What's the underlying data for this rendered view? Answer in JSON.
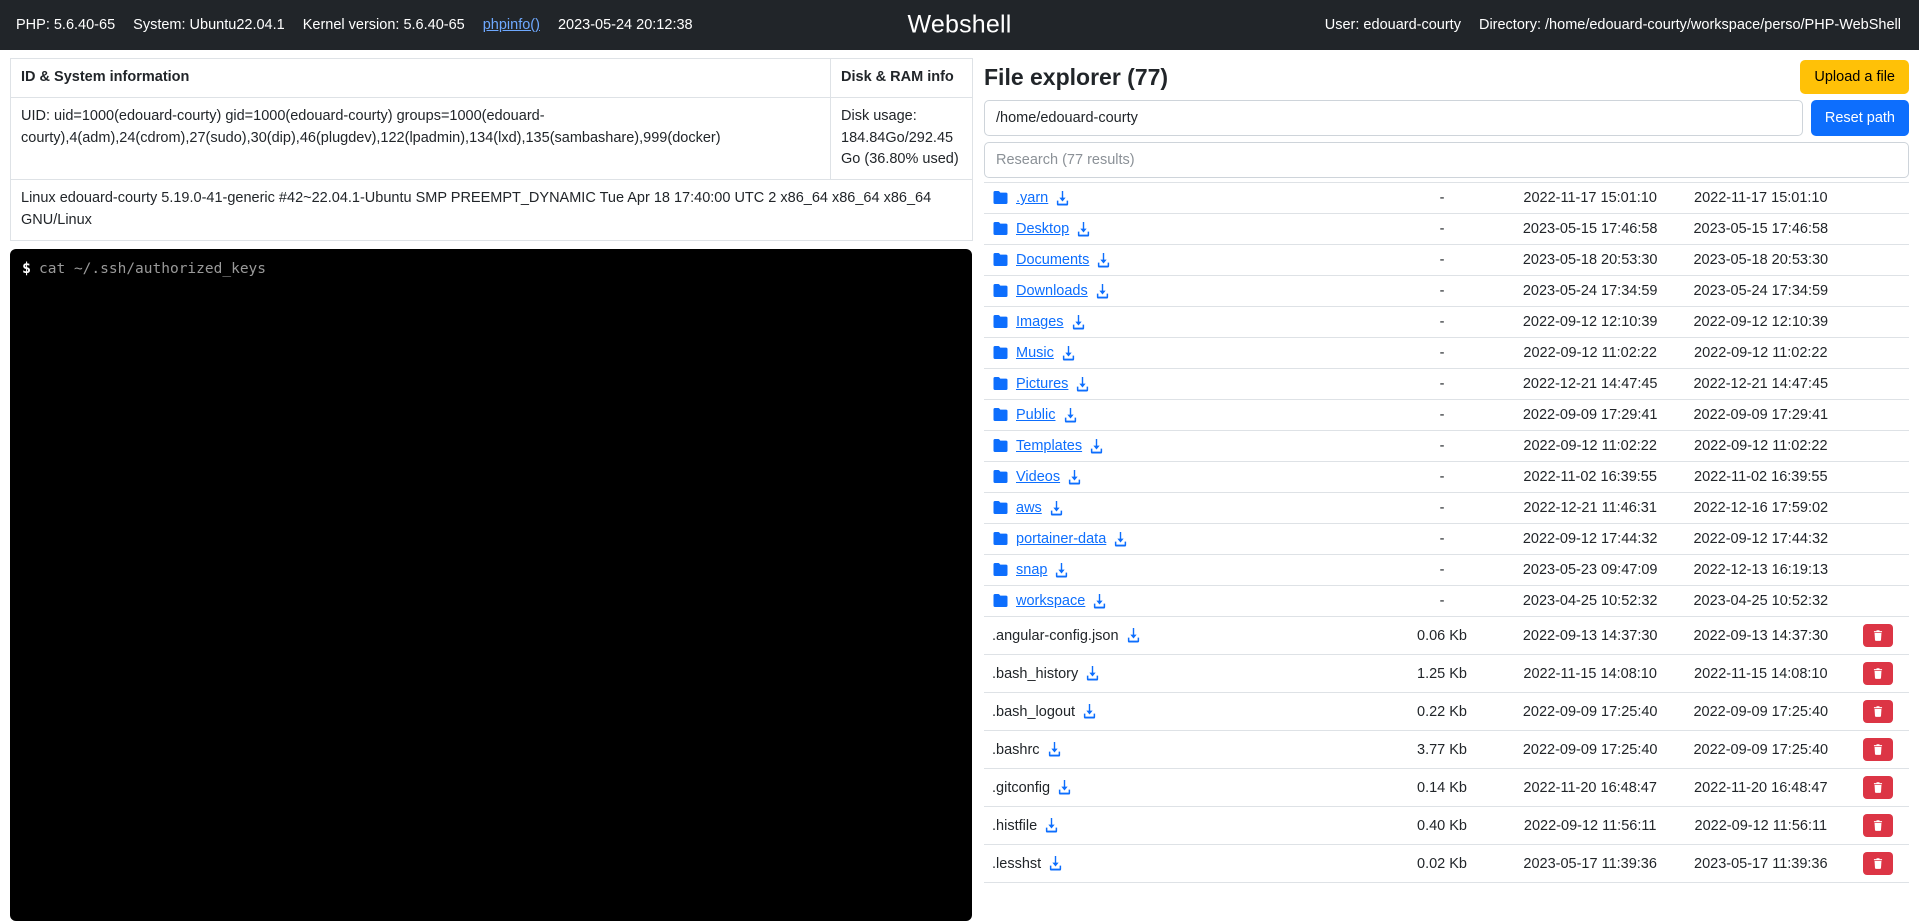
{
  "navbar": {
    "php": "PHP: 5.6.40-65",
    "system": "System: Ubuntu22.04.1",
    "kernel_version": "Kernel version: 5.6.40-65",
    "phpinfo_link": "phpinfo()",
    "datetime": "2023-05-24 20:12:38",
    "title": "Webshell",
    "user": "User: edouard-courty",
    "directory": "Directory: /home/edouard-courty/workspace/perso/PHP-WebShell",
    "bg_color": "#212529",
    "link_color": "#6ea8fe"
  },
  "info": {
    "header_id": "ID & System information",
    "header_disk": "Disk & RAM info",
    "uid": "UID: uid=1000(edouard-courty) gid=1000(edouard-courty) groups=1000(edouard-courty),4(adm),24(cdrom),27(sudo),30(dip),46(plugdev),122(lpadmin),134(lxd),135(sambashare),999(docker)",
    "disk": "Disk usage: 184.84Go/292.45 Go (36.80% used)",
    "uname": "Linux edouard-courty 5.19.0-41-generic #42~22.04.1-Ubuntu SMP PREEMPT_DYNAMIC Tue Apr 18 17:40:00 UTC 2 x86_64 x86_64 x86_64 GNU/Linux"
  },
  "terminal": {
    "prompt": "$",
    "command_placeholder": "cat ~/.ssh/authorized_keys",
    "command_value": "",
    "bg_color": "#000000"
  },
  "explorer": {
    "title": "File explorer (77)",
    "upload_label": "Upload a file",
    "reset_label": "Reset path",
    "path_value": "/home/edouard-courty",
    "path_placeholder": "/home/edouard-courty",
    "search_value": "",
    "search_placeholder": "Research (77 results)",
    "upload_color": "#ffc107",
    "reset_color": "#0d6efd",
    "delete_color": "#dc3545",
    "link_color": "#0d6efd",
    "icons": {
      "folder": "folder-icon",
      "download": "download-icon",
      "delete": "trash-icon"
    },
    "rows": [
      {
        "type": "folder",
        "name": ".yarn",
        "size": "-",
        "modified": "2022-11-17 15:01:10",
        "created": "2022-11-17 15:01:10",
        "deletable": false
      },
      {
        "type": "folder",
        "name": "Desktop",
        "size": "-",
        "modified": "2023-05-15 17:46:58",
        "created": "2023-05-15 17:46:58",
        "deletable": false
      },
      {
        "type": "folder",
        "name": "Documents",
        "size": "-",
        "modified": "2023-05-18 20:53:30",
        "created": "2023-05-18 20:53:30",
        "deletable": false
      },
      {
        "type": "folder",
        "name": "Downloads",
        "size": "-",
        "modified": "2023-05-24 17:34:59",
        "created": "2023-05-24 17:34:59",
        "deletable": false
      },
      {
        "type": "folder",
        "name": "Images",
        "size": "-",
        "modified": "2022-09-12 12:10:39",
        "created": "2022-09-12 12:10:39",
        "deletable": false
      },
      {
        "type": "folder",
        "name": "Music",
        "size": "-",
        "modified": "2022-09-12 11:02:22",
        "created": "2022-09-12 11:02:22",
        "deletable": false
      },
      {
        "type": "folder",
        "name": "Pictures",
        "size": "-",
        "modified": "2022-12-21 14:47:45",
        "created": "2022-12-21 14:47:45",
        "deletable": false
      },
      {
        "type": "folder",
        "name": "Public",
        "size": "-",
        "modified": "2022-09-09 17:29:41",
        "created": "2022-09-09 17:29:41",
        "deletable": false
      },
      {
        "type": "folder",
        "name": "Templates",
        "size": "-",
        "modified": "2022-09-12 11:02:22",
        "created": "2022-09-12 11:02:22",
        "deletable": false
      },
      {
        "type": "folder",
        "name": "Videos",
        "size": "-",
        "modified": "2022-11-02 16:39:55",
        "created": "2022-11-02 16:39:55",
        "deletable": false
      },
      {
        "type": "folder",
        "name": "aws",
        "size": "-",
        "modified": "2022-12-21 11:46:31",
        "created": "2022-12-16 17:59:02",
        "deletable": false
      },
      {
        "type": "folder",
        "name": "portainer-data",
        "size": "-",
        "modified": "2022-09-12 17:44:32",
        "created": "2022-09-12 17:44:32",
        "deletable": false
      },
      {
        "type": "folder",
        "name": "snap",
        "size": "-",
        "modified": "2023-05-23 09:47:09",
        "created": "2022-12-13 16:19:13",
        "deletable": false
      },
      {
        "type": "folder",
        "name": "workspace",
        "size": "-",
        "modified": "2023-04-25 10:52:32",
        "created": "2023-04-25 10:52:32",
        "deletable": false
      },
      {
        "type": "file",
        "name": ".angular-config.json",
        "size": "0.06 Kb",
        "modified": "2022-09-13 14:37:30",
        "created": "2022-09-13 14:37:30",
        "deletable": true
      },
      {
        "type": "file",
        "name": ".bash_history",
        "size": "1.25 Kb",
        "modified": "2022-11-15 14:08:10",
        "created": "2022-11-15 14:08:10",
        "deletable": true
      },
      {
        "type": "file",
        "name": ".bash_logout",
        "size": "0.22 Kb",
        "modified": "2022-09-09 17:25:40",
        "created": "2022-09-09 17:25:40",
        "deletable": true
      },
      {
        "type": "file",
        "name": ".bashrc",
        "size": "3.77 Kb",
        "modified": "2022-09-09 17:25:40",
        "created": "2022-09-09 17:25:40",
        "deletable": true
      },
      {
        "type": "file",
        "name": ".gitconfig",
        "size": "0.14 Kb",
        "modified": "2022-11-20 16:48:47",
        "created": "2022-11-20 16:48:47",
        "deletable": true
      },
      {
        "type": "file",
        "name": ".histfile",
        "size": "0.40 Kb",
        "modified": "2022-09-12 11:56:11",
        "created": "2022-09-12 11:56:11",
        "deletable": true
      },
      {
        "type": "file",
        "name": ".lesshst",
        "size": "0.02 Kb",
        "modified": "2023-05-17 11:39:36",
        "created": "2023-05-17 11:39:36",
        "deletable": true
      }
    ]
  }
}
